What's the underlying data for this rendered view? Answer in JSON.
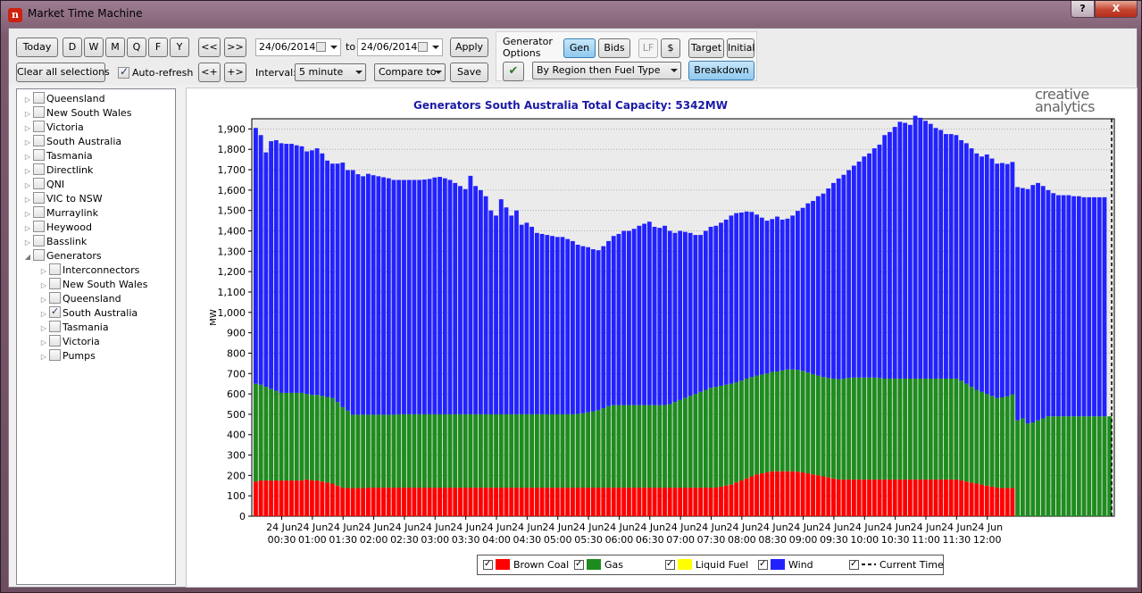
{
  "window": {
    "title": "Market Time Machine",
    "help_label": "?",
    "close_label": "X"
  },
  "toolbar": {
    "today": "Today",
    "d": "D",
    "w": "W",
    "m": "M",
    "q": "Q",
    "f": "F",
    "y": "Y",
    "prev": "<<",
    "next": ">>",
    "step_back": "<+",
    "step_fwd": "+>",
    "clear": "Clear all selections",
    "auto_refresh": "Auto-refresh",
    "date_from": "24/06/2014",
    "to": "to",
    "date_to": "24/06/2014",
    "apply": "Apply",
    "interval_label": "Interval:",
    "interval_value": "5 minute",
    "compare": "Compare to",
    "save": "Save"
  },
  "gen_options": {
    "label_line1": "Generator",
    "label_line2": "Options",
    "gen": "Gen",
    "bids": "Bids",
    "lf": "LF",
    "dollar": "$",
    "target": "Target",
    "initial": "Initial",
    "grouping": "By Region then Fuel Type",
    "breakdown": "Breakdown"
  },
  "tree": [
    {
      "label": "Queensland",
      "level": 0,
      "expanded": false,
      "checked": false
    },
    {
      "label": "New South Wales",
      "level": 0,
      "expanded": false,
      "checked": false
    },
    {
      "label": "Victoria",
      "level": 0,
      "expanded": false,
      "checked": false
    },
    {
      "label": "South Australia",
      "level": 0,
      "expanded": false,
      "checked": false
    },
    {
      "label": "Tasmania",
      "level": 0,
      "expanded": false,
      "checked": false
    },
    {
      "label": "Directlink",
      "level": 0,
      "expanded": false,
      "checked": false
    },
    {
      "label": "QNI",
      "level": 0,
      "expanded": false,
      "checked": false
    },
    {
      "label": "VIC to NSW",
      "level": 0,
      "expanded": false,
      "checked": false
    },
    {
      "label": "Murraylink",
      "level": 0,
      "expanded": false,
      "checked": false
    },
    {
      "label": "Heywood",
      "level": 0,
      "expanded": false,
      "checked": false
    },
    {
      "label": "Basslink",
      "level": 0,
      "expanded": false,
      "checked": false
    },
    {
      "label": "Generators",
      "level": 0,
      "expanded": true,
      "checked": false
    },
    {
      "label": "Interconnectors",
      "level": 1,
      "expanded": false,
      "checked": false
    },
    {
      "label": "New South Wales",
      "level": 1,
      "expanded": false,
      "checked": false
    },
    {
      "label": "Queensland",
      "level": 1,
      "expanded": false,
      "checked": false
    },
    {
      "label": "South Australia",
      "level": 1,
      "expanded": false,
      "checked": true
    },
    {
      "label": "Tasmania",
      "level": 1,
      "expanded": false,
      "checked": false
    },
    {
      "label": "Victoria",
      "level": 1,
      "expanded": false,
      "checked": false
    },
    {
      "label": "Pumps",
      "level": 1,
      "expanded": false,
      "checked": false
    }
  ],
  "brand": {
    "line1": "creative",
    "line2": "analytics"
  },
  "chart_data": {
    "type": "bar",
    "stacked": true,
    "title": "Generators South Australia Total Capacity: 5342MW",
    "ylabel": "MW",
    "ylim": [
      0,
      1950
    ],
    "yticks": [
      0,
      100,
      200,
      300,
      400,
      500,
      600,
      700,
      800,
      900,
      "1,000",
      "1,100",
      "1,200",
      "1,300",
      "1,400",
      "1,500",
      "1,600",
      "1,700",
      "1,800",
      "1,900"
    ],
    "grid": true,
    "xticks": [
      [
        "24 Jun",
        "00:30"
      ],
      [
        "24 Jun",
        "01:00"
      ],
      [
        "24 Jun",
        "01:30"
      ],
      [
        "24 Jun",
        "02:00"
      ],
      [
        "24 Jun",
        "02:30"
      ],
      [
        "24 Jun",
        "03:00"
      ],
      [
        "24 Jun",
        "03:30"
      ],
      [
        "24 Jun",
        "04:00"
      ],
      [
        "24 Jun",
        "04:30"
      ],
      [
        "24 Jun",
        "05:00"
      ],
      [
        "24 Jun",
        "05:30"
      ],
      [
        "24 Jun",
        "06:00"
      ],
      [
        "24 Jun",
        "06:30"
      ],
      [
        "24 Jun",
        "07:00"
      ],
      [
        "24 Jun",
        "07:30"
      ],
      [
        "24 Jun",
        "08:00"
      ],
      [
        "24 Jun",
        "08:30"
      ],
      [
        "24 Jun",
        "09:00"
      ],
      [
        "24 Jun",
        "09:30"
      ],
      [
        "24 Jun",
        "10:00"
      ],
      [
        "24 Jun",
        "10:30"
      ],
      [
        "24 Jun",
        "11:00"
      ],
      [
        "24 Jun",
        "11:30"
      ],
      [
        "24 Jun",
        "12:00"
      ]
    ],
    "intervals_per_tick": 6,
    "first_interval": "00:05",
    "current_time": "12:00",
    "series": [
      {
        "name": "Brown Coal",
        "color": "#ff0000",
        "values": [
          170,
          175,
          175,
          175,
          175,
          175,
          175,
          175,
          175,
          175,
          180,
          175,
          175,
          170,
          165,
          160,
          150,
          140,
          138,
          138,
          138,
          138,
          140,
          140,
          140,
          140,
          140,
          140,
          140,
          140,
          140,
          140,
          140,
          140,
          140,
          140,
          140,
          140,
          140,
          140,
          140,
          140,
          140,
          140,
          140,
          140,
          140,
          140,
          140,
          140,
          140,
          140,
          140,
          140,
          140,
          140,
          140,
          140,
          140,
          140,
          140,
          140,
          140,
          140,
          140,
          140,
          140,
          140,
          140,
          140,
          140,
          140,
          140,
          140,
          140,
          140,
          140,
          140,
          140,
          140,
          140,
          140,
          140,
          140,
          140,
          140,
          140,
          140,
          140,
          140,
          140,
          145,
          150,
          155,
          165,
          175,
          185,
          195,
          205,
          210,
          215,
          220,
          220,
          220,
          220,
          220,
          218,
          215,
          210,
          205,
          200,
          195,
          190,
          185,
          180,
          180,
          180,
          180,
          180,
          180,
          180,
          180,
          180,
          180,
          180,
          180,
          180,
          180,
          180,
          180,
          180,
          180,
          180,
          180,
          180,
          180,
          180,
          180,
          175,
          170,
          165,
          160,
          155,
          150,
          145,
          140,
          138,
          138,
          138,
          0,
          0,
          0,
          0,
          0,
          0,
          0,
          0,
          0,
          0,
          0,
          0,
          0,
          0,
          0,
          0,
          0,
          0,
          0
        ]
      },
      {
        "name": "Gas",
        "color": "#1e8c1e",
        "values": [
          480,
          470,
          460,
          450,
          440,
          430,
          430,
          430,
          430,
          430,
          420,
          420,
          420,
          420,
          420,
          420,
          410,
          395,
          380,
          360,
          360,
          360,
          358,
          358,
          358,
          358,
          358,
          358,
          360,
          360,
          360,
          360,
          360,
          360,
          360,
          360,
          360,
          360,
          360,
          360,
          360,
          360,
          360,
          360,
          360,
          360,
          360,
          360,
          360,
          360,
          360,
          360,
          360,
          360,
          360,
          360,
          360,
          360,
          360,
          360,
          360,
          360,
          360,
          362,
          365,
          370,
          375,
          380,
          390,
          400,
          405,
          405,
          405,
          405,
          405,
          405,
          405,
          405,
          405,
          405,
          405,
          410,
          420,
          430,
          440,
          450,
          460,
          470,
          480,
          490,
          495,
          495,
          495,
          495,
          492,
          490,
          490,
          488,
          485,
          485,
          485,
          488,
          490,
          495,
          500,
          500,
          500,
          498,
          495,
          492,
          490,
          488,
          488,
          490,
          492,
          495,
          498,
          500,
          500,
          500,
          500,
          500,
          498,
          495,
          495,
          495,
          495,
          495,
          495,
          495,
          495,
          495,
          495,
          495,
          495,
          495,
          495,
          495,
          490,
          480,
          470,
          460,
          455,
          450,
          445,
          440,
          445,
          450,
          460,
          470,
          480,
          455,
          460,
          470,
          480,
          490,
          490,
          490,
          490,
          490,
          490,
          490,
          490,
          490,
          490,
          490,
          490,
          490
        ]
      },
      {
        "name": "Liquid Fuel",
        "color": "#ffff00",
        "values": [
          0,
          0,
          0,
          0,
          0,
          0,
          0,
          0,
          0,
          0,
          0,
          0,
          0,
          0,
          0,
          0,
          0,
          0,
          0,
          0,
          0,
          0,
          0,
          0,
          0,
          0,
          0,
          0,
          0,
          0,
          0,
          0,
          0,
          0,
          0,
          0,
          0,
          0,
          0,
          0,
          0,
          0,
          0,
          0,
          0,
          0,
          0,
          0,
          0,
          0,
          0,
          0,
          0,
          0,
          0,
          0,
          0,
          0,
          0,
          0,
          0,
          0,
          0,
          0,
          0,
          0,
          0,
          0,
          0,
          0,
          0,
          0,
          0,
          0,
          0,
          0,
          0,
          0,
          0,
          0,
          0,
          0,
          0,
          0,
          0,
          0,
          0,
          0,
          0,
          0,
          0,
          0,
          0,
          0,
          0,
          0,
          0,
          0,
          0,
          0,
          0,
          0,
          0,
          0,
          0,
          0,
          0,
          0,
          0,
          0,
          0,
          0,
          0,
          0,
          0,
          0,
          0,
          0,
          0,
          0,
          0,
          0,
          0,
          0,
          0,
          0,
          0,
          0,
          0,
          0,
          0,
          0,
          0,
          0,
          0,
          0,
          0,
          0,
          0,
          0,
          0,
          0,
          0,
          0,
          0,
          0,
          0,
          0,
          0,
          0,
          0,
          0,
          0,
          0,
          0,
          0,
          0,
          0,
          0,
          0,
          0,
          0,
          0,
          0,
          0,
          0,
          0,
          0,
          0
        ]
      },
      {
        "name": "Wind",
        "color": "#2222ff",
        "values": [
          1255,
          1225,
          1150,
          1215,
          1230,
          1225,
          1222,
          1222,
          1215,
          1210,
          1190,
          1200,
          1210,
          1190,
          1160,
          1150,
          1170,
          1200,
          1180,
          1200,
          1180,
          1170,
          1182,
          1175,
          1170,
          1165,
          1160,
          1152,
          1150,
          1150,
          1150,
          1150,
          1150,
          1152,
          1155,
          1162,
          1165,
          1158,
          1150,
          1135,
          1120,
          1105,
          1170,
          1120,
          1100,
          1070,
          1000,
          975,
          1055,
          1015,
          975,
          1000,
          930,
          940,
          920,
          890,
          885,
          880,
          875,
          870,
          870,
          860,
          850,
          830,
          820,
          810,
          795,
          785,
          795,
          810,
          830,
          840,
          855,
          855,
          865,
          880,
          890,
          900,
          875,
          870,
          880,
          850,
          830,
          830,
          815,
          800,
          780,
          770,
          780,
          790,
          790,
          800,
          810,
          825,
          830,
          825,
          820,
          810,
          790,
          770,
          750,
          750,
          760,
          740,
          740,
          755,
          780,
          800,
          830,
          850,
          880,
          900,
          930,
          960,
          985,
          1000,
          1020,
          1040,
          1060,
          1085,
          1100,
          1125,
          1145,
          1195,
          1210,
          1235,
          1260,
          1255,
          1245,
          1290,
          1280,
          1265,
          1250,
          1230,
          1220,
          1200,
          1200,
          1195,
          1180,
          1180,
          1170,
          1160,
          1155,
          1175,
          1165,
          1150,
          1150,
          1140,
          1140,
          1145,
          1130,
          1150,
          1165,
          1165,
          1140,
          1110,
          1095,
          1085,
          1085,
          1085,
          1080,
          1080,
          1075,
          1075,
          1075,
          1075,
          1075
        ]
      }
    ],
    "legend": [
      {
        "name": "Brown Coal",
        "color": "#ff0000"
      },
      {
        "name": "Gas",
        "color": "#1e8c1e"
      },
      {
        "name": "Liquid Fuel",
        "color": "#ffff00"
      },
      {
        "name": "Wind",
        "color": "#2222ff"
      },
      {
        "name": "Current Time",
        "color": "#000000"
      }
    ]
  }
}
